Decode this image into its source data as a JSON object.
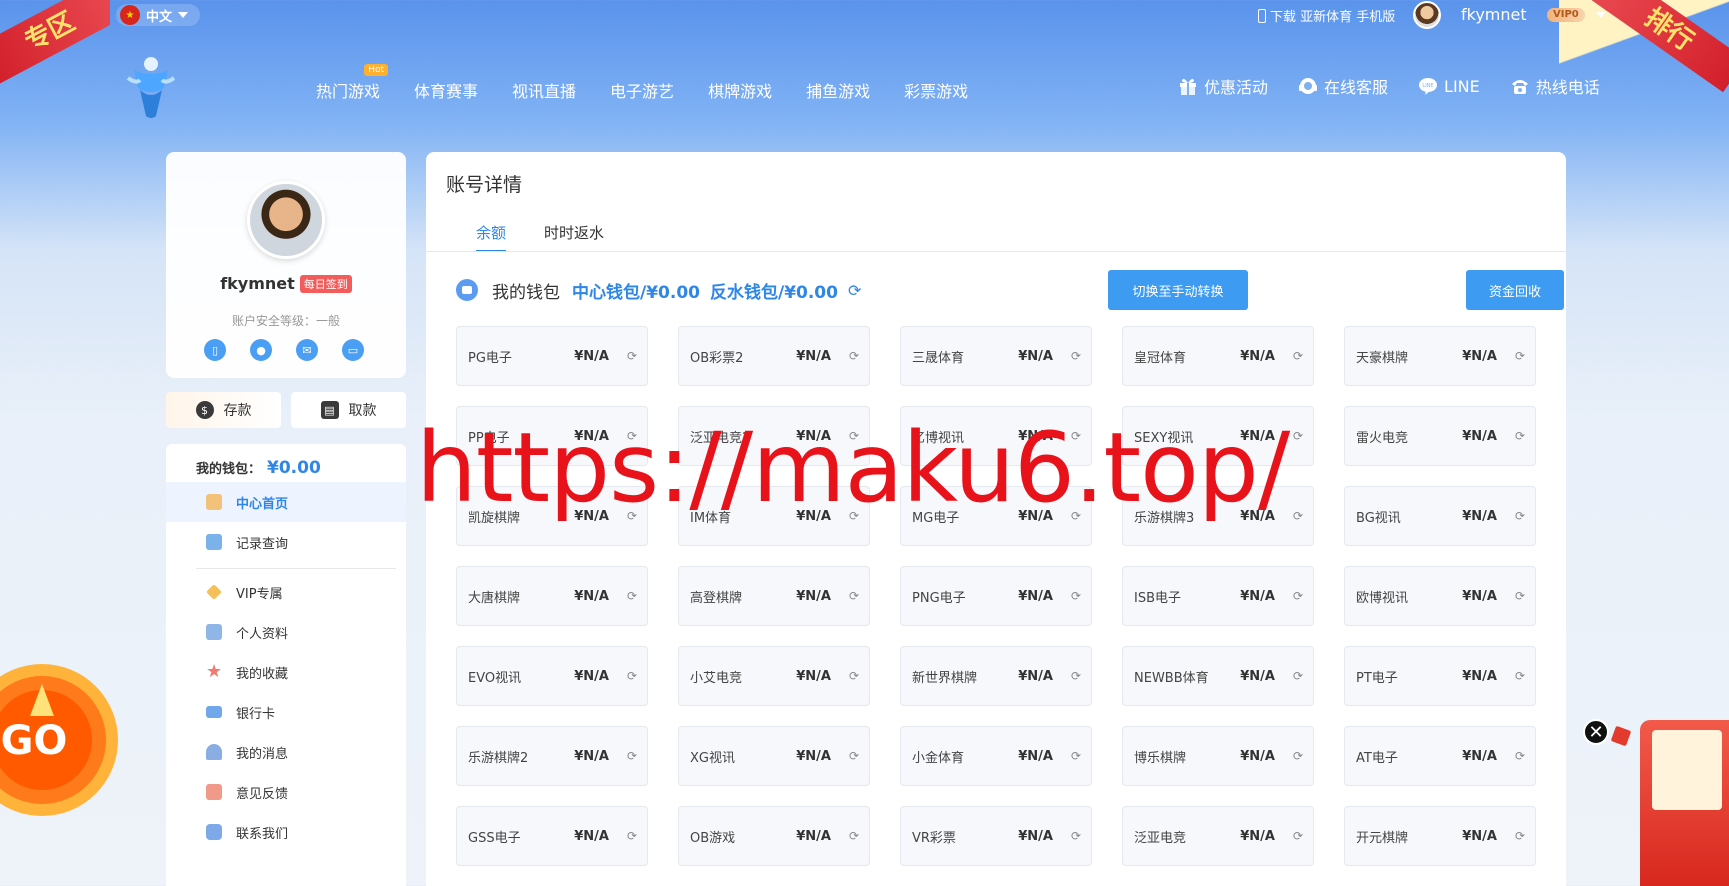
{
  "top": {
    "language": "中文",
    "download_text": "下载 亚新体育 手机版",
    "username": "fkymnet",
    "vip": "VIP0"
  },
  "corner_ribbons": {
    "left": "专区",
    "right": "排行"
  },
  "nav": {
    "items": [
      {
        "label": "热门游戏",
        "badge": "Hot"
      },
      {
        "label": "体育赛事"
      },
      {
        "label": "视讯直播"
      },
      {
        "label": "电子游艺"
      },
      {
        "label": "棋牌游戏"
      },
      {
        "label": "捕鱼游戏"
      },
      {
        "label": "彩票游戏"
      }
    ],
    "right": [
      {
        "label": "优惠活动",
        "icon": "gift-icon"
      },
      {
        "label": "在线客服",
        "icon": "headset-icon"
      },
      {
        "label": "LINE",
        "icon": "line-chat-icon"
      },
      {
        "label": "热线电话",
        "icon": "telephone-icon"
      }
    ]
  },
  "profile": {
    "name": "fkymnet",
    "sign_badge": "每日签到",
    "security": "账户安全等级：一般"
  },
  "actions": {
    "deposit": "存款",
    "withdraw": "取款"
  },
  "menu": {
    "wallet_label": "我的钱包：",
    "wallet_amount": "¥0.00",
    "items": [
      {
        "label": "中心首页",
        "active": true,
        "color": "#f2c27a"
      },
      {
        "label": "记录查询",
        "color": "#7bb2ec"
      },
      {
        "label": "VIP专属",
        "color": "#f5c05a"
      },
      {
        "label": "个人资料",
        "color": "#8fb6e6"
      },
      {
        "label": "我的收藏",
        "color": "#f07b6e"
      },
      {
        "label": "银行卡",
        "color": "#6fa7ea"
      },
      {
        "label": "我的消息",
        "color": "#8aaee3"
      },
      {
        "label": "意见反馈",
        "color": "#f29a8a"
      },
      {
        "label": "联系我们",
        "color": "#7ea9e8"
      }
    ]
  },
  "main": {
    "title": "账号详情",
    "tabs": [
      {
        "label": "余额",
        "active": true
      },
      {
        "label": "时时返水"
      }
    ],
    "wallet": {
      "label": "我的钱包",
      "center": "中心钱包/¥0.00",
      "rebate": "反水钱包/¥0.00",
      "switch_btn": "切换至手动转换",
      "recycle_btn": "资金回收"
    },
    "games": [
      [
        "PG电子",
        "OB彩票2",
        "三晟体育",
        "皇冠体育",
        "天豪棋牌"
      ],
      [
        "PP电子",
        "泛亚电竞2",
        "亿博视讯",
        "SEXY视讯",
        "雷火电竞"
      ],
      [
        "凯旋棋牌",
        "IM体育",
        "MG电子",
        "乐游棋牌3",
        "BG视讯"
      ],
      [
        "大唐棋牌",
        "高登棋牌",
        "PNG电子",
        "ISB电子",
        "欧博视讯"
      ],
      [
        "EVO视讯",
        "小艾电竞",
        "新世界棋牌",
        "NEWBB体育",
        "PT电子"
      ],
      [
        "乐游棋牌2",
        "XG视讯",
        "小金体育",
        "博乐棋牌",
        "AT电子"
      ],
      [
        "GSS电子",
        "OB游戏",
        "VR彩票",
        "泛亚电竞",
        "开元棋牌"
      ]
    ],
    "balance": "¥N/A"
  },
  "watermark": "https://maku6.top/",
  "go_wheel": "GO",
  "close_glyph": "✕"
}
